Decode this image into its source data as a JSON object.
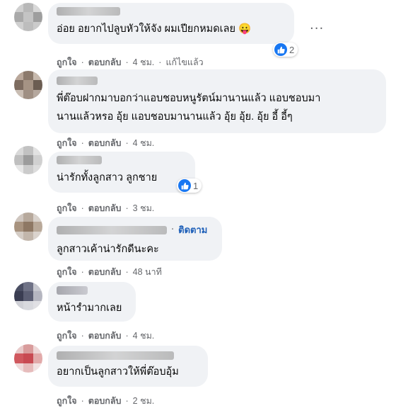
{
  "comments": [
    {
      "text": "อ่อย อยากไปลูบหัวให้จัง ผมเปียกหมดเลย 😛",
      "actions": {
        "like": "ถูกใจ",
        "reply": "ตอบกลับ",
        "time": "4 ชม.",
        "edited": "แก้ไขแล้ว"
      },
      "reactions": {
        "count": "2"
      }
    },
    {
      "text": "พี่ต๊อบฝากมาบอกว่าแอบชอบหนูรัตน์มานานแล้ว แอบชอบมา\nนานแล้วหรอ อุ้ย แอบชอบมานานแล้ว อุ้ย อุ้ย. อุ้ย อี้ อี้ๆ",
      "actions": {
        "like": "ถูกใจ",
        "reply": "ตอบกลับ",
        "time": "4 ชม."
      }
    },
    {
      "text": "น่ารักทั้งลูกสาว ลูกชาย",
      "actions": {
        "like": "ถูกใจ",
        "reply": "ตอบกลับ",
        "time": "3 ชม."
      },
      "reactions": {
        "count": "1"
      }
    },
    {
      "follow": "ติดตาม",
      "text": "ลูกสาวเค้าน่ารักดีนะคะ",
      "actions": {
        "like": "ถูกใจ",
        "reply": "ตอบกลับ",
        "time": "48 นาที"
      }
    },
    {
      "text": "หน้ารำมากเลย",
      "actions": {
        "like": "ถูกใจ",
        "reply": "ตอบกลับ",
        "time": "4 ชม."
      }
    },
    {
      "text": "อยากเป็นลูกสาวให้พี่ต๊อบอุ้ม",
      "actions": {
        "like": "ถูกใจ",
        "reply": "ตอบกลับ",
        "time": "2 ชม."
      }
    }
  ],
  "more_menu": "···",
  "separator": "·",
  "colors": {
    "bubble": "#f0f2f5",
    "link": "#1d5fb8",
    "meta": "#65676b",
    "like": "#1877f2"
  },
  "icons": {
    "more": "more-horizontal-icon",
    "like": "like-thumb-icon"
  }
}
